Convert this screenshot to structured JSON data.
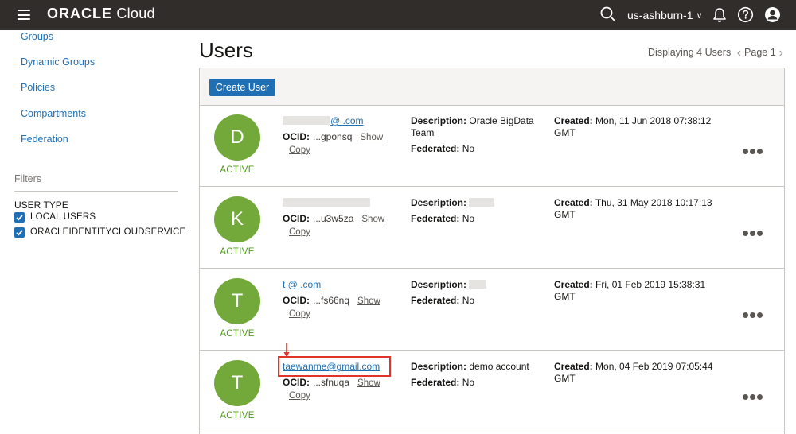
{
  "header": {
    "brand_bold": "ORACLE",
    "brand_light": "Cloud",
    "region": "us-ashburn-1"
  },
  "sidebar": {
    "items": [
      {
        "label": "Groups"
      },
      {
        "label": "Dynamic Groups"
      },
      {
        "label": "Policies"
      },
      {
        "label": "Compartments"
      },
      {
        "label": "Federation"
      }
    ],
    "filters_title": "Filters",
    "user_type_label": "USER TYPE",
    "checkboxes": [
      {
        "label": "LOCAL USERS",
        "checked": true
      },
      {
        "label": "ORACLEIDENTITYCLOUDSERVICE",
        "checked": true
      }
    ]
  },
  "main": {
    "title": "Users",
    "pager_text": "Displaying 4 Users",
    "page_label": "Page 1",
    "create_button": "Create User",
    "labels": {
      "ocid": "OCID:",
      "show": "Show",
      "copy": "Copy",
      "description": "Description:",
      "federated": "Federated:",
      "created": "Created:"
    },
    "users": [
      {
        "initial": "D",
        "status": "ACTIVE",
        "email": "@ .com",
        "ocid": "...gponsq",
        "description": "Oracle BigData Team",
        "federated": "No",
        "created": "Mon, 11 Jun 2018 07:38:12 GMT"
      },
      {
        "initial": "K",
        "status": "ACTIVE",
        "email": "",
        "ocid": "...u3w5za",
        "description": "",
        "federated": "No",
        "created": "Thu, 31 May 2018 10:17:13 GMT"
      },
      {
        "initial": "T",
        "status": "ACTIVE",
        "email": "t @ .com",
        "ocid": "...fs66nq",
        "description": "",
        "federated": "No",
        "created": "Fri, 01 Feb 2019 15:38:31 GMT"
      },
      {
        "initial": "T",
        "status": "ACTIVE",
        "email": "taewanme@gmail.com",
        "ocid": "...sfnuqa",
        "description": "demo account",
        "federated": "No",
        "created": "Mon, 04 Feb 2019 07:05:44 GMT"
      }
    ]
  },
  "colors": {
    "topbar": "#312d2a",
    "link": "#1f6fb5",
    "active_green": "#4f9a1c",
    "avatar_green": "#73a93b",
    "highlight_red": "#e0332a"
  }
}
